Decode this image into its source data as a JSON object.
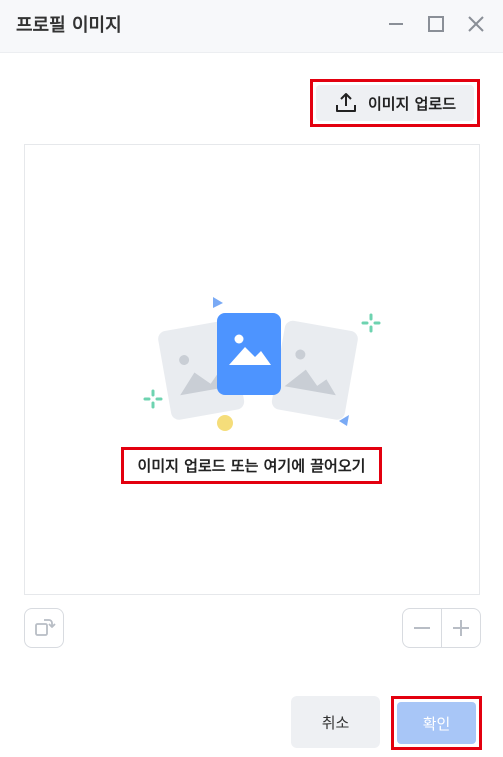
{
  "window": {
    "title": "프로필 이미지"
  },
  "toolbar": {
    "upload_label": "이미지 업로드"
  },
  "dropzone": {
    "prompt": "이미지 업로드 또는 여기에 끌어오기"
  },
  "footer": {
    "cancel_label": "취소",
    "confirm_label": "확인"
  },
  "colors": {
    "accent": "#4d94ff",
    "confirm_disabled": "#a8c6f7",
    "highlight": "#e3000f"
  }
}
